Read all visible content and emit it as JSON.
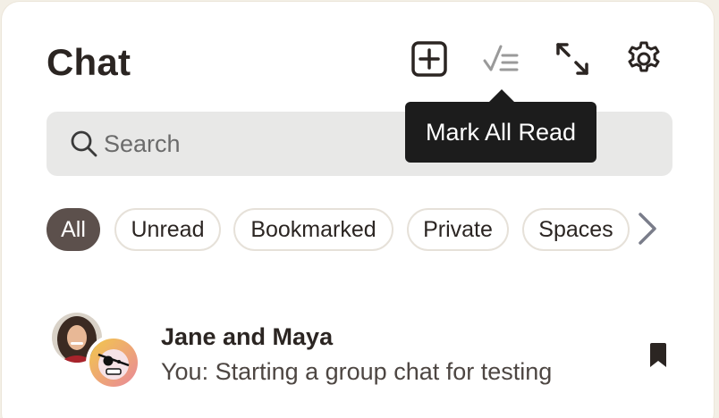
{
  "header": {
    "title": "Chat",
    "tools": [
      {
        "name": "new-chat-icon"
      },
      {
        "name": "mark-all-read-icon"
      },
      {
        "name": "expand-icon"
      },
      {
        "name": "gear-icon"
      }
    ]
  },
  "tooltip": {
    "text": "Mark All Read"
  },
  "search": {
    "placeholder": "Search",
    "icon": "search-icon"
  },
  "filters": {
    "items": [
      {
        "label": "All",
        "active": true
      },
      {
        "label": "Unread",
        "active": false
      },
      {
        "label": "Bookmarked",
        "active": false
      },
      {
        "label": "Private",
        "active": false
      },
      {
        "label": "Spaces",
        "active": false
      }
    ],
    "more_icon": "chevron-right-icon"
  },
  "chats": [
    {
      "name": "Jane and Maya",
      "preview": "You: Starting a group chat for testing",
      "bookmarked": true
    }
  ],
  "colors": {
    "accent_chip": "#5c504c",
    "text": "#2b2522",
    "tooltip_bg": "#1c1c1c",
    "search_bg": "#e8e8e7"
  }
}
